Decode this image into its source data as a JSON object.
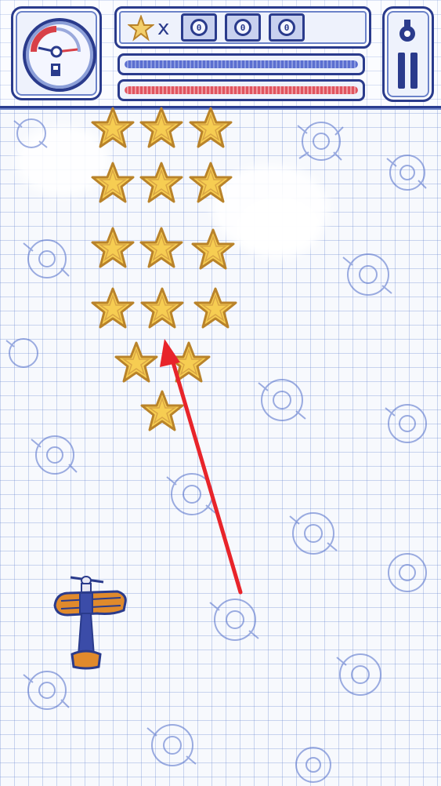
{
  "hud": {
    "fuel_level": 0.25,
    "star_counter": {
      "multiplier_symbol": "x",
      "digits": [
        "0",
        "0",
        "0"
      ]
    },
    "health_bar": {
      "level": 1.0,
      "color": "#5b6fd0"
    },
    "ammo_bar": {
      "level": 1.0,
      "color": "#e05560"
    }
  },
  "playfield": {
    "star_color": "#f6cd52",
    "star_stroke": "#b9832a",
    "annotation_arrow_color": "#e8242a"
  },
  "icons": [
    "fuel-gauge-icon",
    "star-icon",
    "pause-icon",
    "bomb-icon",
    "plane-icon"
  ]
}
